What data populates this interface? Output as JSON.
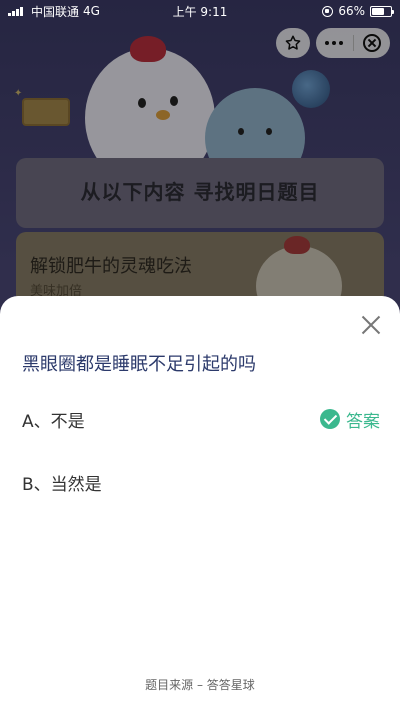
{
  "status_bar": {
    "carrier": "中国联通",
    "network": "4G",
    "time": "上午 9:11",
    "battery": "66%"
  },
  "background": {
    "banner_title": "从以下内容 寻找明日题目",
    "card_title": "解锁肥牛的灵魂吃法",
    "card_subtitle": "美味加倍"
  },
  "quiz": {
    "question": "黑眼圈都是睡眠不足引起的吗",
    "options": [
      {
        "label": "A、不是",
        "is_answer": true
      },
      {
        "label": "B、当然是",
        "is_answer": false
      }
    ],
    "answer_label": "答案",
    "footer": "题目来源 – 答答星球"
  },
  "colors": {
    "answer": "#3bb88e",
    "question_text": "#2c3a6b"
  },
  "icons": [
    "star-icon",
    "more-icon",
    "close-circle-icon",
    "close-icon",
    "check-icon"
  ]
}
